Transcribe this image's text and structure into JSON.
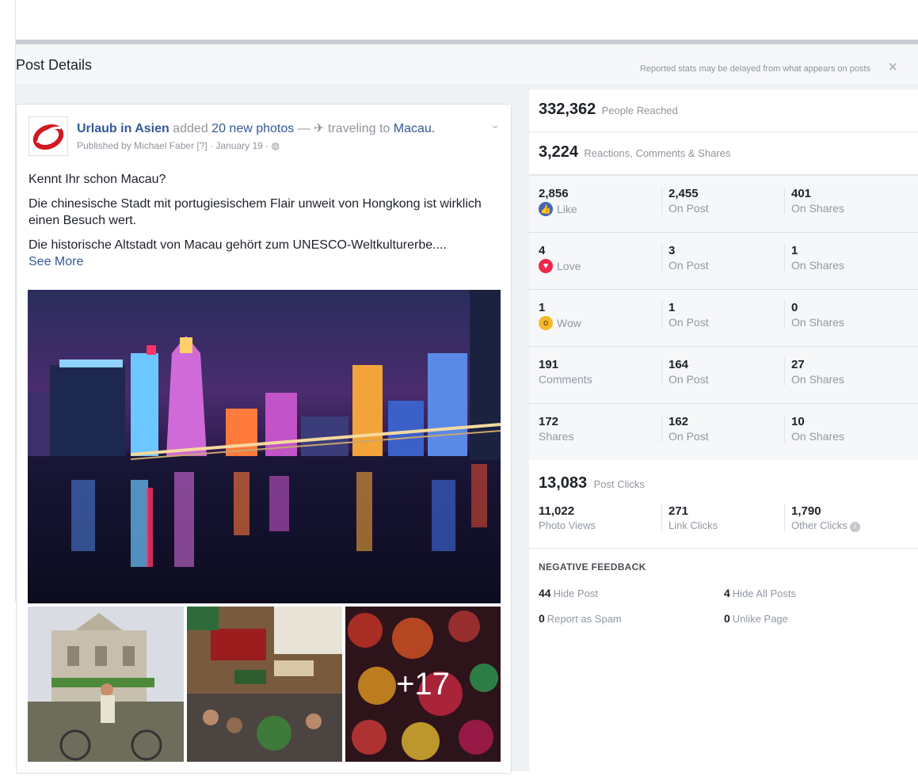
{
  "dialog": {
    "title": "Post Details",
    "note": "Reported stats may be delayed from what appears on posts",
    "close": "×"
  },
  "post": {
    "page_name": "Urlaub in Asien",
    "added": "added",
    "photos_link": "20 new photos",
    "dash": "—",
    "activity": "traveling to",
    "place": "Macau.",
    "published": "Published by Michael Faber [?] · January 19 ·",
    "text": [
      "Kennt Ihr schon Macau?",
      "Die chinesische Stadt mit portugiesischem Flair unweit von Hongkong ist wirklich einen Besuch wert.",
      "Die historische Altstadt von Macau gehört zum UNESCO-Weltkulturerbe...."
    ],
    "see_more": "See More",
    "more_photos": "+17"
  },
  "stats": {
    "reached": {
      "value": "332,362",
      "label": "People Reached"
    },
    "engagement": {
      "value": "3,224",
      "label": "Reactions, Comments & Shares"
    },
    "rows": [
      {
        "total": "2,856",
        "label": "Like",
        "icon": "like-icon",
        "on_post": "2,455",
        "on_shares": "401"
      },
      {
        "total": "4",
        "label": "Love",
        "icon": "love-icon",
        "on_post": "3",
        "on_shares": "1"
      },
      {
        "total": "1",
        "label": "Wow",
        "icon": "wow-icon",
        "on_post": "1",
        "on_shares": "0"
      },
      {
        "total": "191",
        "label": "Comments",
        "icon": "",
        "on_post": "164",
        "on_shares": "27"
      },
      {
        "total": "172",
        "label": "Shares",
        "icon": "",
        "on_post": "162",
        "on_shares": "10"
      }
    ],
    "on_post_label": "On Post",
    "on_shares_label": "On Shares",
    "clicks": {
      "value": "13,083",
      "label": "Post Clicks",
      "items": [
        {
          "value": "11,022",
          "label": "Photo Views"
        },
        {
          "value": "271",
          "label": "Link Clicks"
        },
        {
          "value": "1,790",
          "label": "Other Clicks"
        }
      ]
    },
    "negative": {
      "title": "NEGATIVE FEEDBACK",
      "items": [
        {
          "value": "44",
          "label": "Hide Post"
        },
        {
          "value": "4",
          "label": "Hide All Posts"
        },
        {
          "value": "0",
          "label": "Report as Spam"
        },
        {
          "value": "0",
          "label": "Unlike Page"
        }
      ]
    }
  },
  "colors": {
    "link": "#365899",
    "like": "#4267b2",
    "love": "#f0284a",
    "wow": "#f7b928"
  }
}
